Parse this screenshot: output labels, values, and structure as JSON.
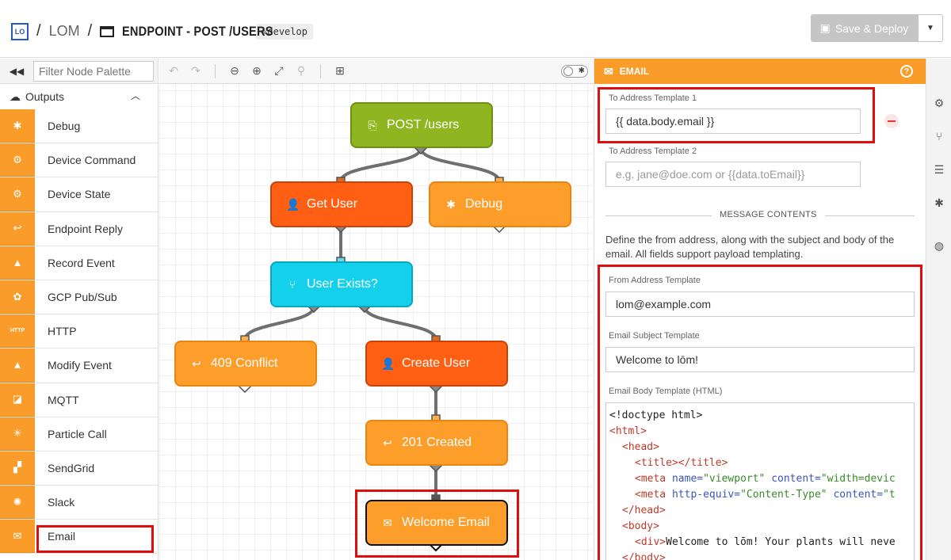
{
  "header": {
    "logo": "LO",
    "crumb_sep1": "/",
    "app": "LOM",
    "crumb_sep2": "/",
    "title": "ENDPOINT - POST /USERS",
    "branch": "develop",
    "save_label": "Save & Deploy"
  },
  "palette": {
    "filter_placeholder": "Filter Node Palette",
    "section": "Outputs",
    "items": [
      {
        "label": "Debug",
        "icon": "bug-icon"
      },
      {
        "label": "Device Command",
        "icon": "gear-icon"
      },
      {
        "label": "Device State",
        "icon": "gear-icon"
      },
      {
        "label": "Endpoint Reply",
        "icon": "reply-icon"
      },
      {
        "label": "Record Event",
        "icon": "warning-plus-icon"
      },
      {
        "label": "GCP Pub/Sub",
        "icon": "cloud-icon"
      },
      {
        "label": "HTTP",
        "icon": "http-icon"
      },
      {
        "label": "Modify Event",
        "icon": "warning-edit-icon"
      },
      {
        "label": "MQTT",
        "icon": "mqtt-icon"
      },
      {
        "label": "Particle Call",
        "icon": "particle-icon"
      },
      {
        "label": "SendGrid",
        "icon": "sendgrid-icon"
      },
      {
        "label": "Slack",
        "icon": "slack-icon"
      },
      {
        "label": "Email",
        "icon": "envelope-icon"
      }
    ]
  },
  "canvas": {
    "nodes": {
      "post_users": "POST /users",
      "get_user": "Get User",
      "debug": "Debug",
      "user_exists": "User Exists?",
      "conflict": "409 Conflict",
      "create_user": "Create User",
      "created": "201 Created",
      "welcome_email": "Welcome Email"
    }
  },
  "panel": {
    "title": "EMAIL",
    "to1_label": "To Address Template 1",
    "to1_value": "{{ data.body.email }}",
    "to2_label": "To Address Template 2",
    "to2_placeholder": "e.g. jane@doe.com or {{data.toEmail}}",
    "section": "MESSAGE CONTENTS",
    "description": "Define the from address, along with the subject and body of the email. All fields support payload templating.",
    "from_label": "From Address Template",
    "from_value": "lom@example.com",
    "subject_label": "Email Subject Template",
    "subject_value": "Welcome to lōm!",
    "body_label": "Email Body Template (HTML)",
    "code": {
      "l1": "<!doctype html>",
      "l2": "<html>",
      "l3": "<head>",
      "l4": "<title></title>",
      "l5a": "<meta ",
      "l5b": "name=",
      "l5c": "\"viewport\" ",
      "l5d": "content=",
      "l5e": "\"width=devic",
      "l6a": "<meta ",
      "l6b": "http-equiv=",
      "l6c": "\"Content-Type\" ",
      "l6d": "content=",
      "l6e": "\"t",
      "l7": "</head>",
      "l8": "<body>",
      "l9a": "<div>",
      "l9b": "Welcome to lōm! Your plants will neve",
      "l10": "</body>"
    }
  }
}
